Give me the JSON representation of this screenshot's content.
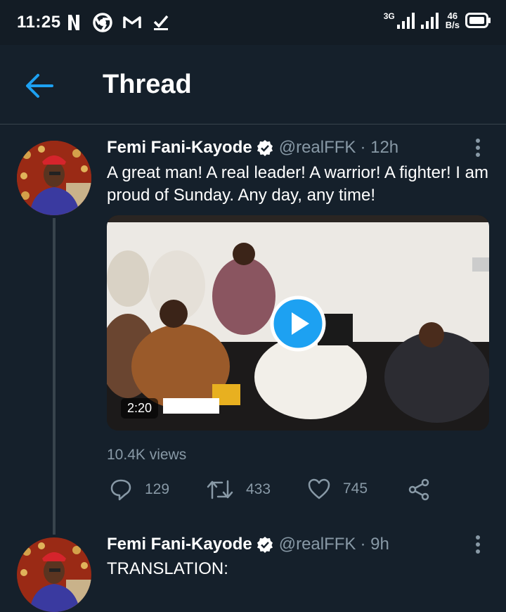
{
  "status_bar": {
    "time": "11:25",
    "network_type": "3G",
    "speed_value": "46",
    "speed_unit": "B/s"
  },
  "header": {
    "title": "Thread"
  },
  "tweets": [
    {
      "name": "Femi Fani-Kayode",
      "handle": "@realFFK",
      "time": "· 12h",
      "text": "A great man! A real leader! A warrior! A fighter! I am proud of Sunday. Any day, any time!",
      "video_duration": "2:20",
      "views": "10.4K views",
      "replies": "129",
      "retweets": "433",
      "likes": "745"
    },
    {
      "name": "Femi Fani-Kayode",
      "handle": "@realFFK",
      "time": "· 9h",
      "text": "TRANSLATION:"
    }
  ],
  "colors": {
    "background": "#15202b",
    "accent": "#1da1f2",
    "secondary_text": "#8899a6",
    "divider": "#38444d"
  },
  "icons": [
    "netflix-icon",
    "chrome-icon",
    "gmail-icon",
    "download-done-icon",
    "signal-icon",
    "battery-icon",
    "back-arrow-icon",
    "verified-icon",
    "more-vertical-icon",
    "play-icon",
    "reply-icon",
    "retweet-icon",
    "like-icon",
    "share-icon"
  ]
}
